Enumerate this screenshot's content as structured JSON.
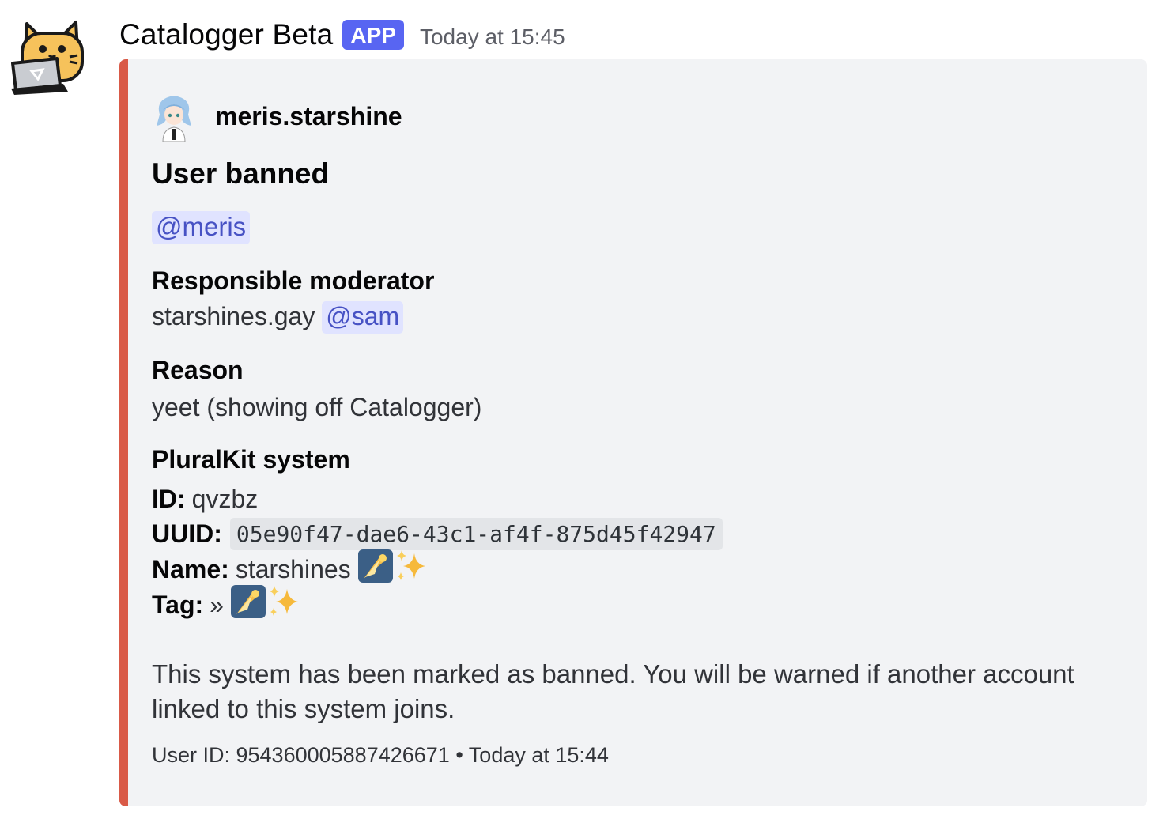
{
  "message": {
    "bot_name": "Catalogger Beta",
    "badge": "APP",
    "timestamp": "Today at 15:45"
  },
  "embed": {
    "accent_color": "#d95a47",
    "author": "meris.starshine",
    "title": "User banned",
    "description_mention": "@meris",
    "fields": {
      "moderator_label": "Responsible moderator",
      "moderator_user": "starshines.gay",
      "moderator_mention": "@sam",
      "reason_label": "Reason",
      "reason_value": "yeet (showing off Catalogger)",
      "system_label": "PluralKit system"
    },
    "system": {
      "id_label": "ID:",
      "id_value": "qvzbz",
      "uuid_label": "UUID:",
      "uuid_value": "05e90f47-dae6-43c1-af4f-875d45f42947",
      "name_label": "Name:",
      "name_value": "starshines",
      "tag_label": "Tag:",
      "tag_value": "»",
      "emojis": [
        "comet-emoji",
        "sparkles-emoji"
      ]
    },
    "notice": "This system has been marked as banned. You will be warned if another account linked to this system joins.",
    "footer": {
      "user_id": "User ID: 954360005887426671",
      "separator": "•",
      "time": "Today at 15:44"
    }
  },
  "colors": {
    "badge": "#5865f2",
    "mention_bg": "#e0e3ff",
    "mention_text": "#4752c4",
    "embed_bg": "#f2f3f5"
  }
}
